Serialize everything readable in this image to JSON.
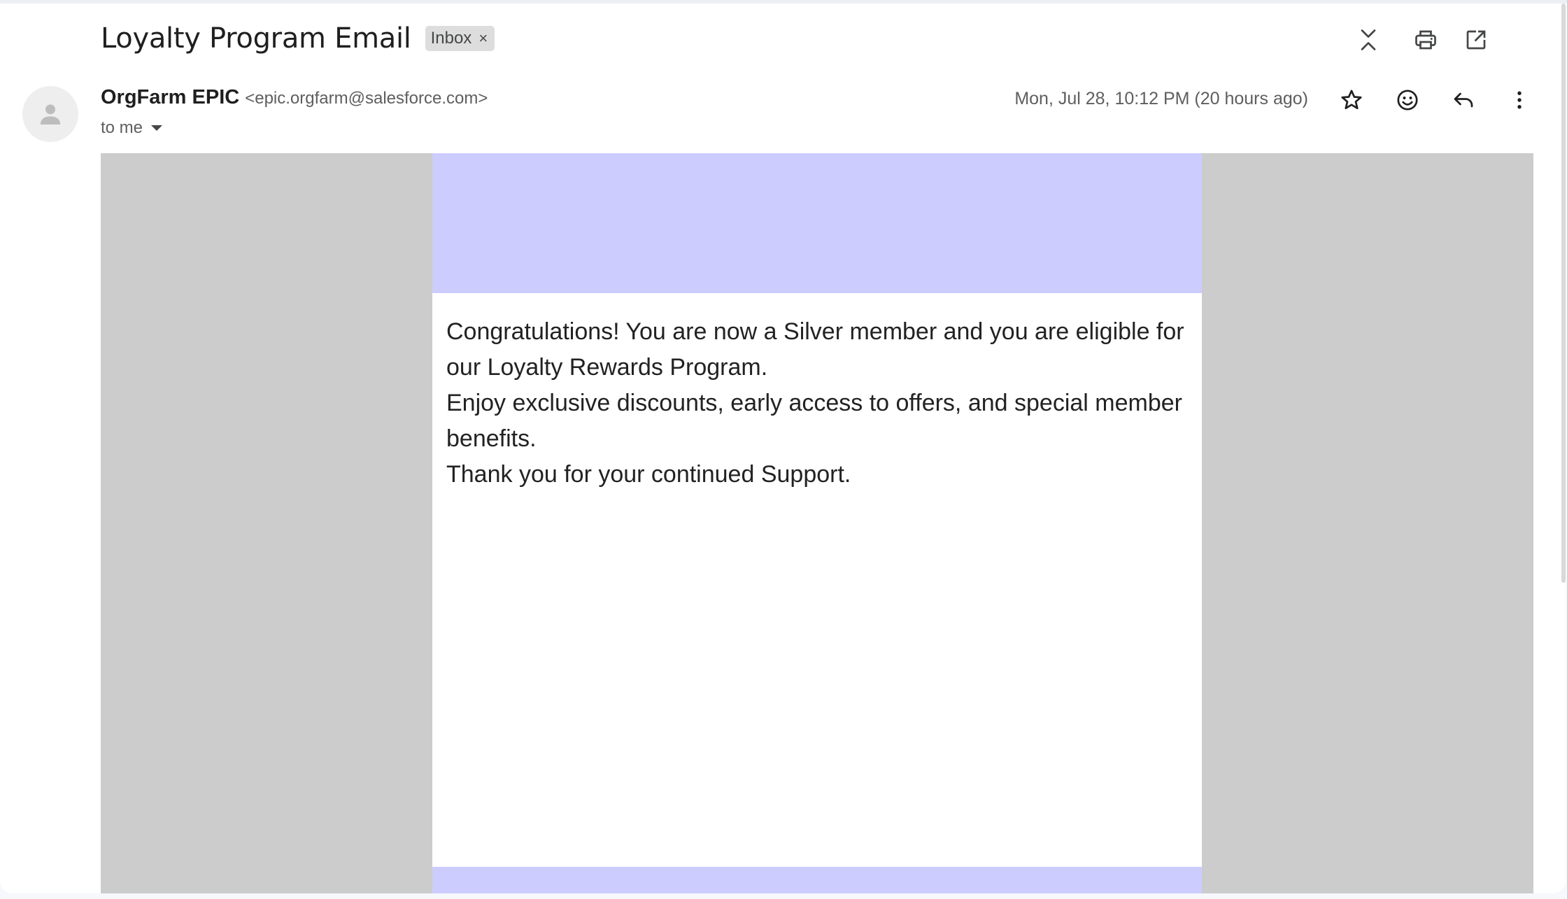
{
  "thread": {
    "subject": "Loyalty Program Email",
    "label": "Inbox",
    "label_remove": "×"
  },
  "icons": {
    "collapse": "collapse-all-icon",
    "print": "print-icon",
    "open_new": "open-in-new-window-icon",
    "star": "star-icon",
    "emoji": "emoji-reaction-icon",
    "reply": "reply-icon",
    "more": "more-vertical-icon",
    "avatar": "person-avatar-icon"
  },
  "message": {
    "sender_name": "OrgFarm EPIC",
    "sender_email": "<epic.orgfarm@salesforce.com>",
    "recipient": "to me",
    "date": "Mon, Jul 28, 10:12 PM (20 hours ago)",
    "body": {
      "line1": "Congratulations! You are now a Silver member and you are eligible for our Loyalty Rewards Program.",
      "line2": "Enjoy exclusive discounts, early access to offers, and special member benefits.",
      "line3": "Thank you for your continued Support."
    }
  },
  "colors": {
    "banner": "#ccccff",
    "outer_background": "#cccccc",
    "content_background": "#ffffff"
  }
}
